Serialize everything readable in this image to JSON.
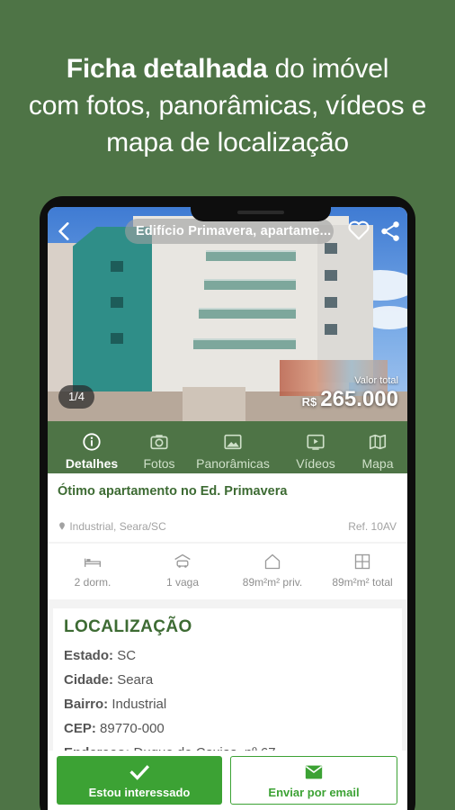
{
  "headline": {
    "bold": "Ficha detalhada",
    "line1_rest": " do imóvel",
    "line2": "com fotos, panorâmicas, vídeos e",
    "line3": "mapa de localização"
  },
  "hero": {
    "title": "Edifício Primavera, apartame...",
    "photo_counter": "1/4",
    "price_label": "Valor total",
    "currency": "R$",
    "price": "265.000"
  },
  "tabs": [
    {
      "label": "Detalhes",
      "icon": "info-icon",
      "active": true
    },
    {
      "label": "Fotos",
      "icon": "camera-icon",
      "active": false
    },
    {
      "label": "Panorâmicas",
      "icon": "image-icon",
      "active": false
    },
    {
      "label": "Vídeos",
      "icon": "video-icon",
      "active": false
    },
    {
      "label": "Mapa",
      "icon": "map-icon",
      "active": false
    }
  ],
  "listing": {
    "title": "Ótimo apartamento no Ed. Primavera",
    "location": "Industrial, Seara/SC",
    "ref": "Ref. 10AV"
  },
  "features": [
    {
      "label": "2 dorm.",
      "icon": "bed-icon"
    },
    {
      "label": "1 vaga",
      "icon": "car-icon"
    },
    {
      "label": "89m²m² priv.",
      "icon": "house-icon"
    },
    {
      "label": "89m²m² total",
      "icon": "floorplan-icon"
    }
  ],
  "location_section": {
    "title": "LOCALIZAÇÃO",
    "items": [
      {
        "key": "Estado:",
        "value": "SC"
      },
      {
        "key": "Cidade:",
        "value": "Seara"
      },
      {
        "key": "Bairro:",
        "value": "Industrial"
      },
      {
        "key": "CEP:",
        "value": "89770-000"
      },
      {
        "key": "Endereço:",
        "value": "Duque de Caxias, nº 67"
      }
    ]
  },
  "actions": {
    "interested": "Estou interessado",
    "email": "Enviar por email"
  },
  "colors": {
    "background": "#4e7446",
    "brand_green": "#3ca234",
    "title_green": "#3d6b33"
  }
}
